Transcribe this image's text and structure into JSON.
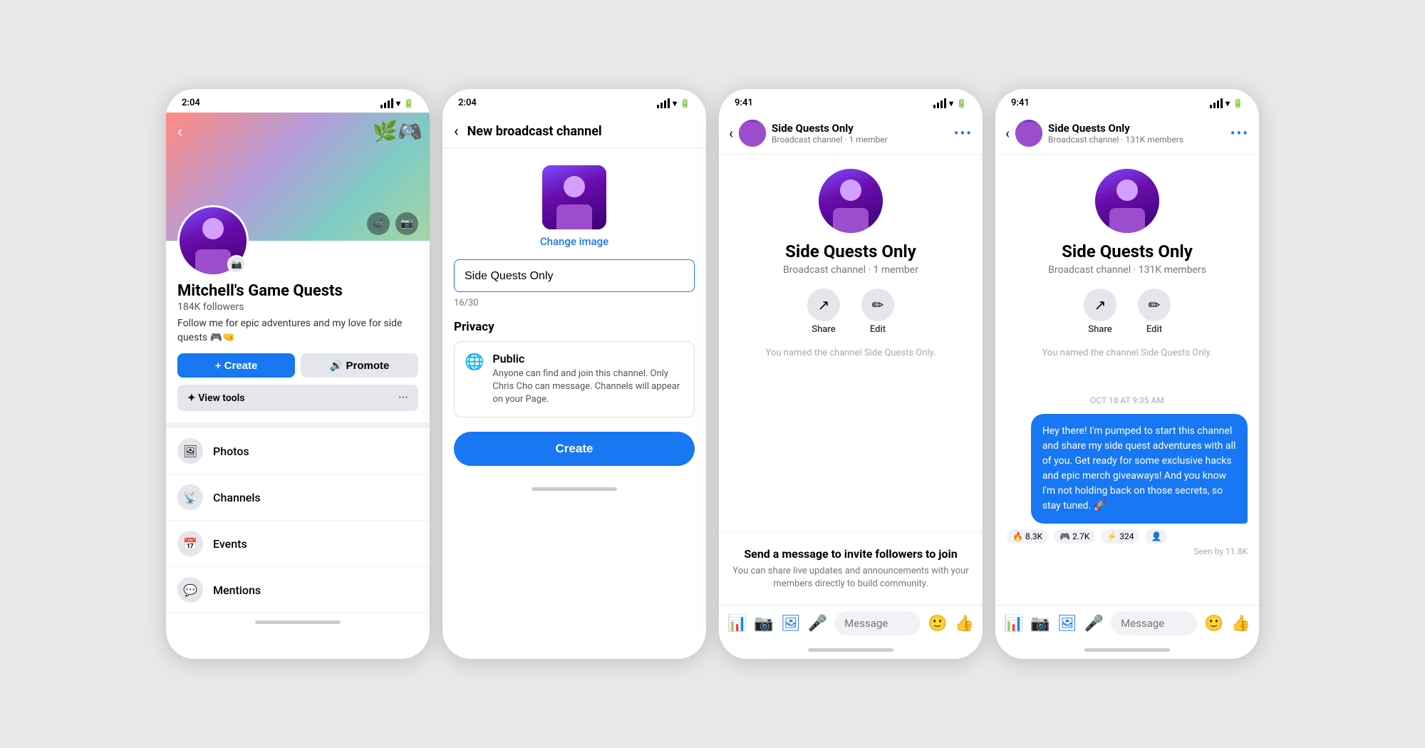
{
  "screen1": {
    "status_time": "2:04",
    "nav_title": "Mitchell's Game Quests",
    "profile_name": "Mitchell's Game Quests",
    "followers": "184K followers",
    "bio": "Follow me for epic adventures and my love for side quests 🎮🤜",
    "btn_create": "+ Create",
    "btn_promote": "🔊 Promote",
    "view_tools": "✦ View tools",
    "menu_items": [
      {
        "icon": "🖼",
        "label": "Photos"
      },
      {
        "icon": "📡",
        "label": "Channels"
      },
      {
        "icon": "📅",
        "label": "Events"
      },
      {
        "icon": "💬",
        "label": "Mentions"
      }
    ]
  },
  "screen2": {
    "status_time": "2:04",
    "screen_title": "New broadcast channel",
    "change_image": "Change image",
    "input_value": "Side Quests Only",
    "char_count": "16/30",
    "privacy_label": "Privacy",
    "privacy_title": "Public",
    "privacy_desc": "Anyone can find and join this channel. Only Chris Cho can message. Channels will appear on your Page.",
    "btn_create": "Create"
  },
  "screen3": {
    "status_time": "9:41",
    "channel_name": "Side Quests Only",
    "channel_sub": "Broadcast channel · 1 member",
    "channel_name_large": "Side Quests Only",
    "channel_meta_large": "Broadcast channel · 1 member",
    "action_share": "Share",
    "action_edit": "Edit",
    "named_text": "You named the channel Side Quests Only.",
    "invite_title": "Send a message to invite followers to join",
    "invite_desc": "You can share live updates and announcements with your members directly to build community.",
    "message_placeholder": "Message"
  },
  "screen4": {
    "status_time": "9:41",
    "channel_name": "Side Quests Only",
    "channel_sub": "Broadcast channel · 131K members",
    "channel_name_large": "Side Quests Only",
    "channel_meta_large": "Broadcast channel · 131K members",
    "action_share": "Share",
    "action_edit": "Edit",
    "named_text": "You named the channel Side Quests Only.",
    "date_label": "OCT 18 AT 9:35 AM",
    "chat_message": "Hey there! I'm pumped to start this channel and share my side quest adventures with all of you. Get ready for some exclusive hacks and epic merch giveaways! And you know I'm not holding back on those secrets, so stay tuned. 🚀",
    "reactions": [
      {
        "emoji": "🔥",
        "count": "8.3K"
      },
      {
        "emoji": "🎮",
        "count": "2.7K"
      },
      {
        "emoji": "⚡",
        "count": "324"
      },
      {
        "emoji": "👤",
        "count": ""
      }
    ],
    "seen_label": "Seen by 11.8K",
    "message_placeholder": "Message"
  }
}
